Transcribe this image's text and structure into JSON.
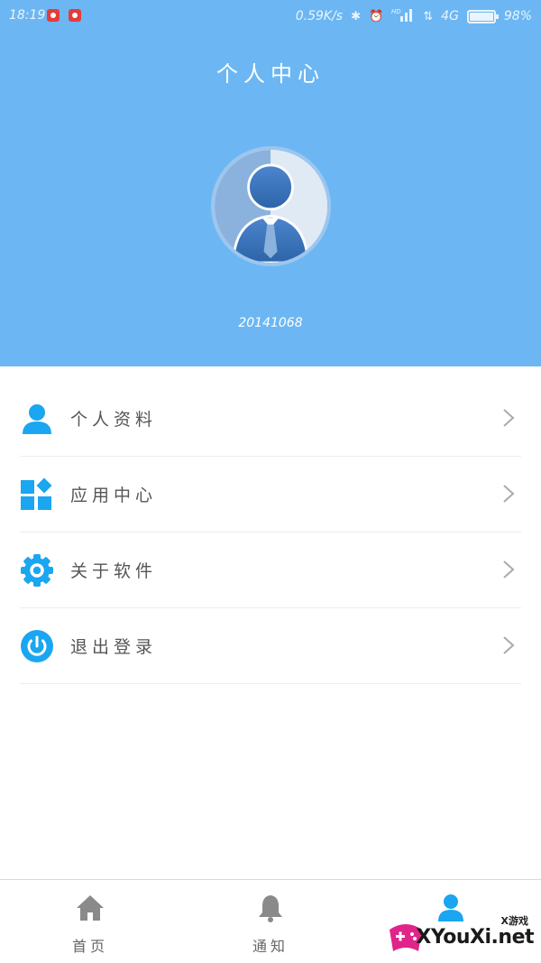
{
  "status_bar": {
    "time": "18:19",
    "network_speed": "0.59K/s",
    "network_type": "4G",
    "battery": "98%",
    "icons": [
      "notification-icon",
      "notification-icon",
      "bluetooth-icon",
      "alarm-icon",
      "hd-icon",
      "signal-icon",
      "data-arrows-icon",
      "battery-icon"
    ]
  },
  "header": {
    "title": "个人中心",
    "user_id": "20141068",
    "background_color": "#6cb7f3"
  },
  "menu": {
    "items": [
      {
        "label": "个人资料",
        "icon": "person-icon"
      },
      {
        "label": "应用中心",
        "icon": "apps-icon"
      },
      {
        "label": "关于软件",
        "icon": "gear-icon"
      },
      {
        "label": "退出登录",
        "icon": "power-icon"
      }
    ],
    "icon_color": "#1aa6f0"
  },
  "bottom_nav": {
    "tabs": [
      {
        "label": "首页",
        "icon": "home-icon"
      },
      {
        "label": "通知",
        "icon": "bell-icon"
      },
      {
        "label": "",
        "icon": "person-icon"
      }
    ]
  },
  "watermark": {
    "small": "X游戏",
    "text": "XYouXi.net"
  }
}
